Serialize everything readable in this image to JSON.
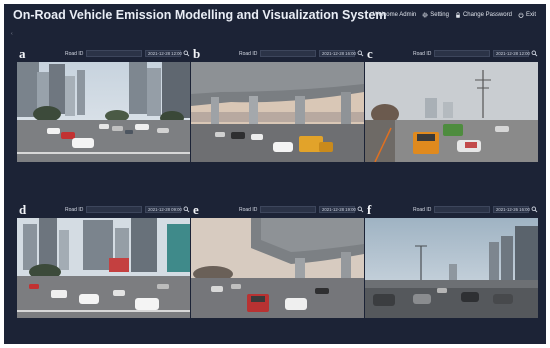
{
  "app": {
    "title": "On-Road Vehicle Emission Modelling and Visualization System",
    "back_marker": "‹"
  },
  "topnav": {
    "welcome": "Welcome Admin",
    "setting": "Setting",
    "change_password": "Change Password",
    "exit": "Exit"
  },
  "panels": [
    {
      "letter": "a",
      "road_id_label": "Road ID",
      "road_id_value": "",
      "datetime": "2021-12-28 12:00",
      "scene": "city-intersection"
    },
    {
      "letter": "b",
      "road_id_label": "Road ID",
      "road_id_value": "",
      "datetime": "2021-12-28 16:00",
      "scene": "under-overpass"
    },
    {
      "letter": "c",
      "road_id_label": "Road ID",
      "road_id_value": "",
      "datetime": "2021-12-28 12:00",
      "scene": "trucks-road"
    },
    {
      "letter": "d",
      "road_id_label": "Road ID",
      "road_id_value": "",
      "datetime": "2021-12-28 09:00",
      "scene": "city-intersection-2"
    },
    {
      "letter": "e",
      "road_id_label": "Road ID",
      "road_id_value": "",
      "datetime": "2021-12-28 19:00",
      "scene": "under-overpass-2"
    },
    {
      "letter": "f",
      "road_id_label": "Road ID",
      "road_id_value": "",
      "datetime": "2021-12-26 16:00",
      "scene": "highway-towers"
    }
  ],
  "colors": {
    "background": "#1c2336",
    "title": "#e9edf5",
    "input_bg": "#2b3347"
  },
  "icons": {
    "setting": "gear-icon",
    "change_password": "lock-icon",
    "exit": "power-icon",
    "search": "search-icon"
  }
}
